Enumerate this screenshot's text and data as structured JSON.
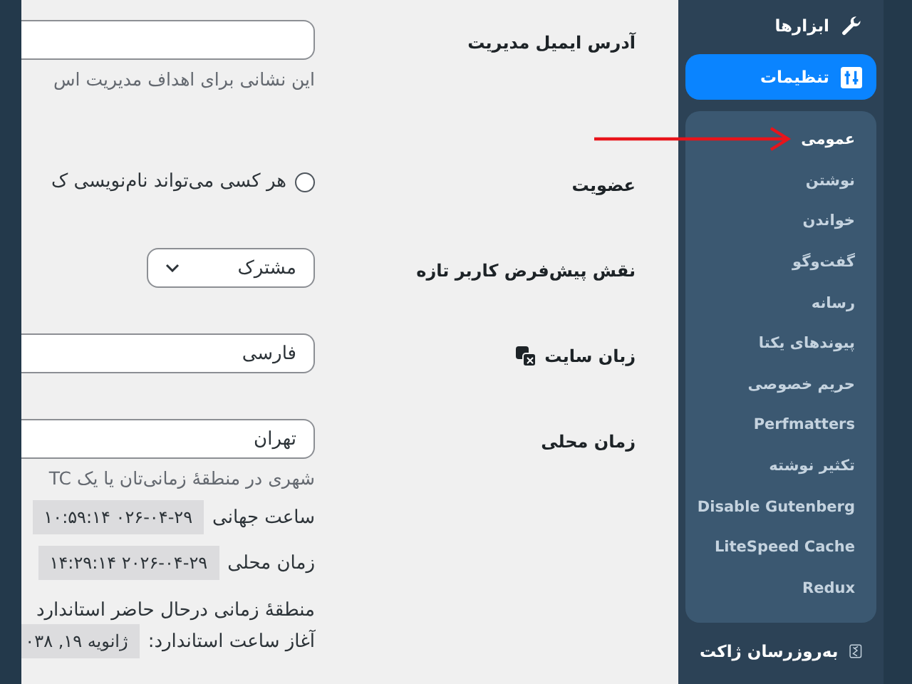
{
  "form": {
    "rows": [
      {
        "kind": "input",
        "label": "آدرس ایمیل مدیریت",
        "hint": "این نشانی برای اهداف مدیریت اس"
      },
      {
        "kind": "radio",
        "label": "عضویت",
        "option": "هر کسی می‌تواند نام‌نویسی ک",
        "checked": false
      },
      {
        "kind": "select",
        "label": "نقش پیش‌فرض کاربر تازه",
        "value": "مشترک"
      },
      {
        "kind": "language",
        "label": "زبان سایت",
        "value": "فارسی"
      },
      {
        "kind": "input",
        "label": "زمان محلی",
        "value": "تهران",
        "hint": "شهری در منطقهٔ زمانی‌تان یا یک TC",
        "clocks": [
          {
            "label": "ساعت جهانی",
            "value": "۰۲۶-۰۴-۲۹ ۱۰:۵۹:۱۴"
          },
          {
            "label": "زمان محلی",
            "value": "۲۰۲۶-۰۴-۲۹ ۱۴:۲۹:۱۴"
          }
        ],
        "note": "منطقهٔ زمانی درحال حاضر استاندارد",
        "start": {
          "label": "آغاز ساعت استاندارد:",
          "value": "ژانویه ۱۹, ۰۳۸"
        }
      }
    ]
  },
  "sidebar": {
    "menu": [
      {
        "label": "ابزارها",
        "selected": false
      },
      {
        "label": "تنظیمات",
        "selected": true,
        "submenu": [
          {
            "label": "عمومی",
            "selected": true
          },
          {
            "label": "نوشتن",
            "selected": false
          },
          {
            "label": "خواندن",
            "selected": false
          },
          {
            "label": "گفت‌وگو",
            "selected": false
          },
          {
            "label": "رسانه",
            "selected": false
          },
          {
            "label": "پیوندهای یکتا",
            "selected": false
          },
          {
            "label": "حریم خصوصی",
            "selected": false
          },
          {
            "label": "Perfmatters",
            "selected": false
          },
          {
            "label": "تکثیر نوشته",
            "selected": false
          },
          {
            "label": "Disable Gutenberg",
            "selected": false
          },
          {
            "label": "LiteSpeed Cache",
            "selected": false
          },
          {
            "label": "Redux",
            "selected": false
          }
        ]
      },
      {
        "label": "به‌روزرسان ژاکت",
        "selected": false
      }
    ]
  }
}
